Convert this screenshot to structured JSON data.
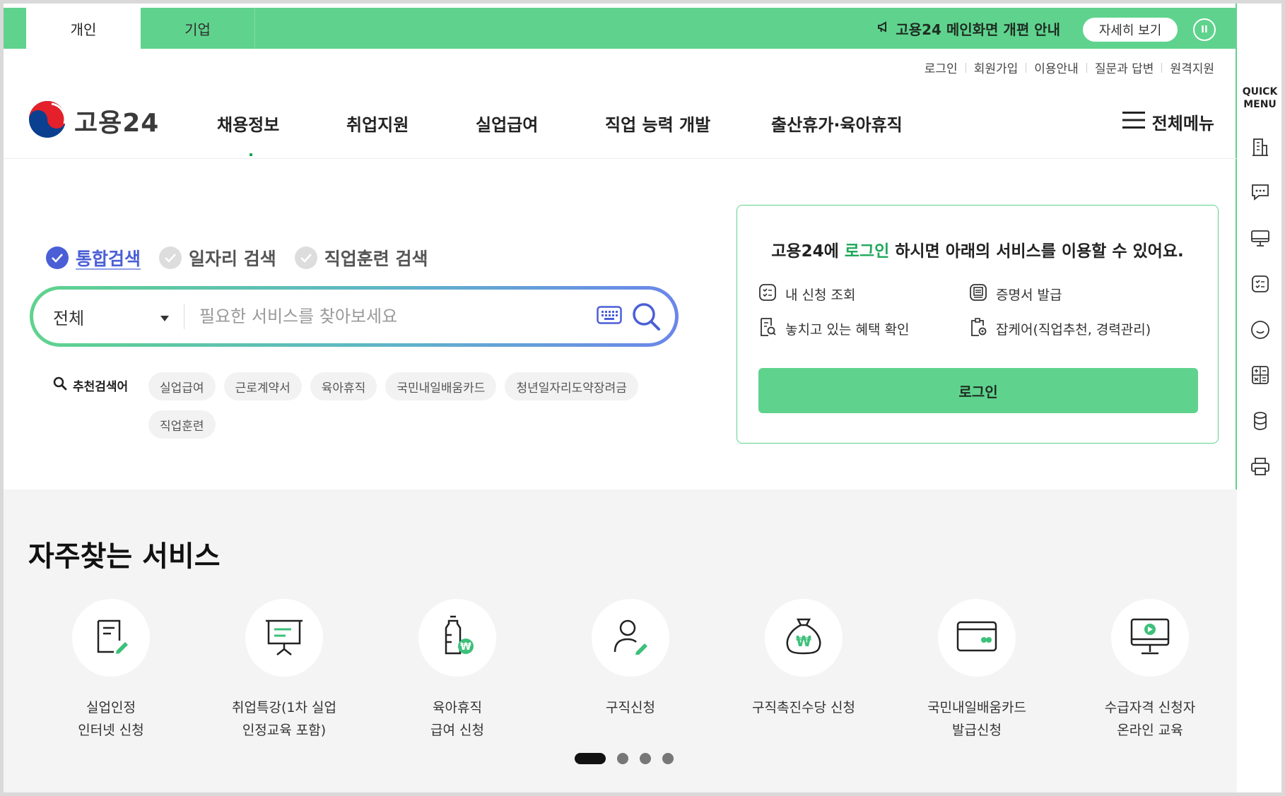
{
  "topbar": {
    "tabs": [
      {
        "label": "개인"
      },
      {
        "label": "기업"
      }
    ],
    "notice": "고용24 메인화면 개편 안내",
    "detail_button": "자세히 보기",
    "pause_label": "II"
  },
  "util_links": [
    "로그인",
    "회원가입",
    "이용안내",
    "질문과 답변",
    "원격지원"
  ],
  "logo": {
    "text": "고용24"
  },
  "nav": [
    "채용정보",
    "취업지원",
    "실업급여",
    "직업 능력 개발",
    "출산휴가·육아휴직"
  ],
  "menu_all": "전체메뉴",
  "search": {
    "tabs": [
      "통합검색",
      "일자리 검색",
      "직업훈련 검색"
    ],
    "category": "전체",
    "placeholder": "필요한 서비스를 찾아보세요",
    "recommend_label": "추천검색어",
    "keywords": [
      "실업급여",
      "근로계약서",
      "육아휴직",
      "국민내일배움카드",
      "청년일자리도약장려금",
      "직업훈련"
    ]
  },
  "login_card": {
    "title_pre": "고용24에 ",
    "title_hl": "로그인",
    "title_post": " 하시면 아래의 서비스를 이용할 수 있어요.",
    "items": [
      "내 신청 조회",
      "증명서 발급",
      "놓치고 있는 혜택 확인",
      "잡케어(직업추천, 경력관리)"
    ],
    "button": "로그인"
  },
  "frequent": {
    "title": "자주찾는 서비스",
    "services": [
      {
        "line1": "실업인정",
        "line2": "인터넷 신청",
        "icon": "document-pen-icon"
      },
      {
        "line1": "취업특강(1차 실업",
        "line2": "인정교육 포함)",
        "icon": "presentation-icon"
      },
      {
        "line1": "육아휴직",
        "line2": "급여 신청",
        "icon": "baby-bottle-icon"
      },
      {
        "line1": "구직신청",
        "line2": "",
        "icon": "person-pen-icon"
      },
      {
        "line1": "구직촉진수당 신청",
        "line2": "",
        "icon": "money-bag-icon"
      },
      {
        "line1": "국민내일배움카드",
        "line2": "발급신청",
        "icon": "card-icon"
      },
      {
        "line1": "수급자격 신청자",
        "line2": "온라인 교육",
        "icon": "monitor-play-icon"
      }
    ]
  },
  "quick_menu": {
    "title_line1": "QUICK",
    "title_line2": "MENU"
  },
  "colors": {
    "brand": "#5fd38d",
    "accent_blue": "#4a5fd6",
    "highlight": "#1fa85a"
  }
}
